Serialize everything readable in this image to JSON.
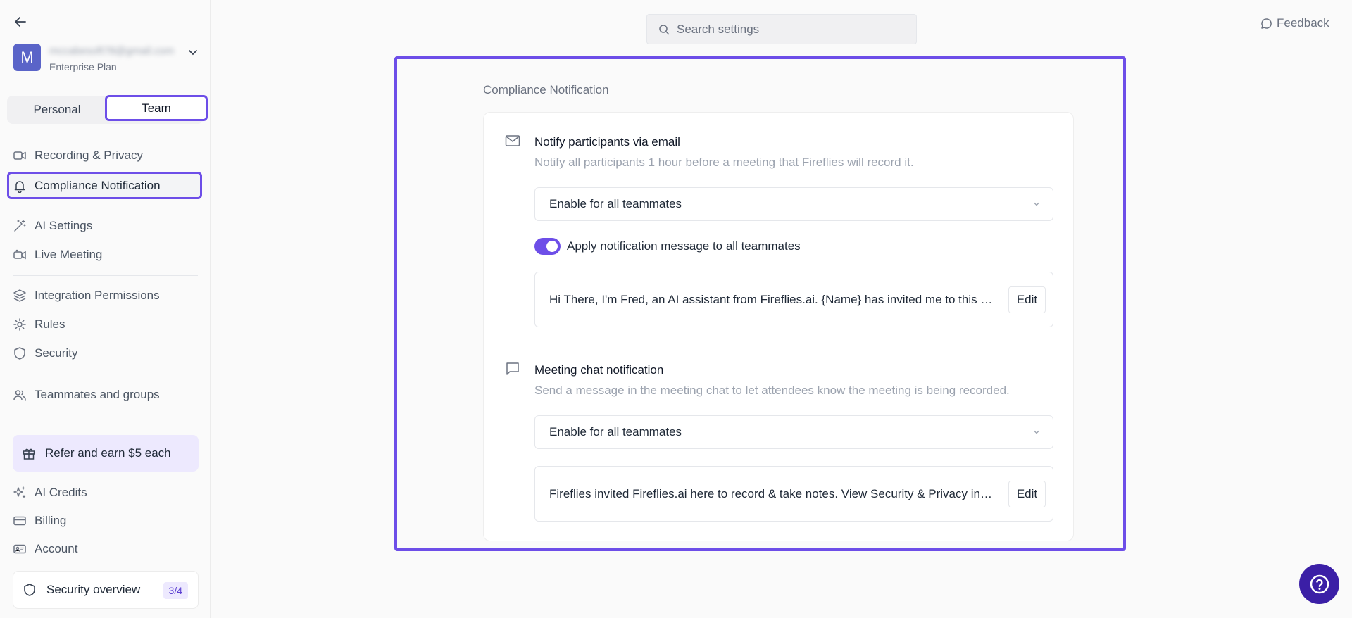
{
  "account": {
    "avatar_letter": "M",
    "email": "mccabesoft78@gmail.com",
    "plan": "Enterprise Plan"
  },
  "scope_tabs": {
    "personal": "Personal",
    "team": "Team"
  },
  "sidebar": {
    "items": [
      {
        "label": "Recording & Privacy",
        "icon": "video-icon"
      },
      {
        "label": "Compliance Notification",
        "icon": "bell-icon"
      },
      {
        "label": "AI Settings",
        "icon": "magic-wand-icon"
      },
      {
        "label": "Live Meeting",
        "icon": "live-video-icon"
      },
      {
        "label": "Integration Permissions",
        "icon": "layers-icon"
      },
      {
        "label": "Rules",
        "icon": "gear-icon"
      },
      {
        "label": "Security",
        "icon": "shield-icon"
      },
      {
        "label": "Teammates and groups",
        "icon": "users-icon"
      },
      {
        "label": "AI Credits",
        "icon": "sparkle-icon"
      },
      {
        "label": "Billing",
        "icon": "credit-card-icon"
      },
      {
        "label": "Account",
        "icon": "id-card-icon"
      }
    ],
    "refer": "Refer and earn $5 each",
    "security_overview": {
      "label": "Security overview",
      "badge": "3/4"
    }
  },
  "search": {
    "placeholder": "Search settings"
  },
  "feedback": "Feedback",
  "main": {
    "section_title": "Compliance Notification",
    "email": {
      "title": "Notify participants via email",
      "desc": "Notify all participants 1 hour before a meeting that Fireflies will record it.",
      "select_value": "Enable for all teammates",
      "toggle_label": "Apply notification message to all teammates",
      "message": "Hi There, I'm Fred, an AI assistant from Fireflies.ai. {Name} has invited me to this meeting to record and take notes.",
      "edit": "Edit"
    },
    "chat": {
      "title": "Meeting chat notification",
      "desc": "Send a message in the meeting chat to let attendees know the meeting is being recorded.",
      "select_value": "Enable for all teammates",
      "message": "Fireflies invited Fireflies.ai here to record & take notes. View Security & Privacy info.",
      "edit": "Edit"
    }
  },
  "colors": {
    "accent": "#6d4ee8",
    "help_button": "#3b1fa6"
  }
}
